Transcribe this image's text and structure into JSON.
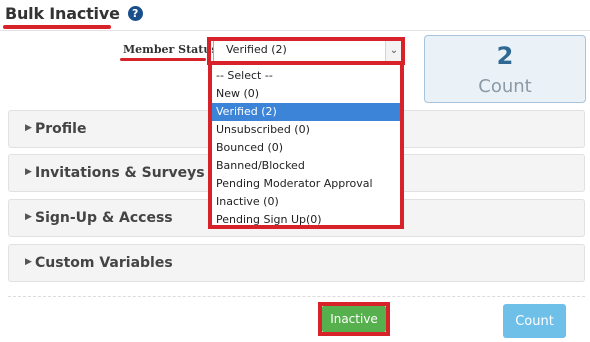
{
  "header": {
    "title": "Bulk Inactive",
    "help_icon": "question-circle-icon"
  },
  "filter": {
    "label": "Member Status",
    "selected": "Verified (2)",
    "options": [
      "-- Select --",
      "New (0)",
      "Verified (2)",
      "Unsubscribed (0)",
      "Bounced (0)",
      "Banned/Blocked",
      "Pending Moderator Approval",
      "Inactive (0)",
      "Pending Sign Up(0)"
    ]
  },
  "count_box": {
    "value": "2",
    "label": "Count"
  },
  "panels": [
    {
      "label": "Profile"
    },
    {
      "label": "Invitations & Surveys"
    },
    {
      "label": "Sign-Up & Access"
    },
    {
      "label": "Custom Variables"
    }
  ],
  "actions": {
    "inactive_label": "Inactive",
    "count_label": "Count"
  },
  "colors": {
    "highlight": "#d7222a",
    "selected_option": "#3b84d8",
    "inactive_button": "#56b04d",
    "count_button": "#6fc0e8"
  }
}
